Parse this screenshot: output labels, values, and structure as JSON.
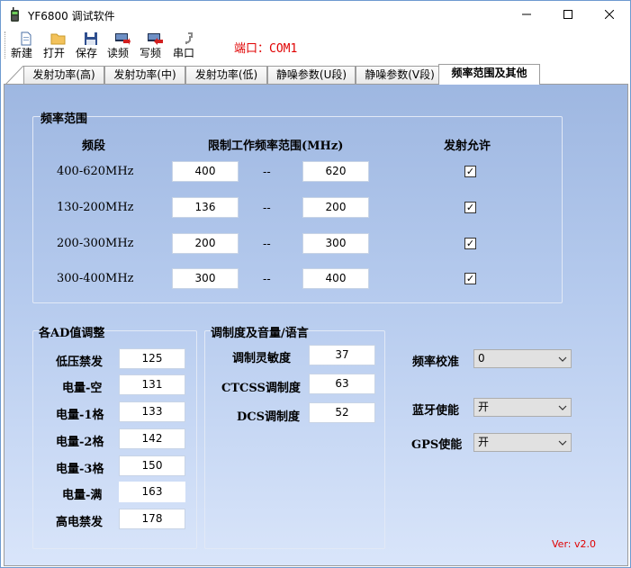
{
  "window": {
    "title": "YF6800 调试软件"
  },
  "toolbar": {
    "new_label": "新建",
    "open_label": "打开",
    "save_label": "保存",
    "read_label": "读频",
    "write_label": "写频",
    "port_btn_label": "串口",
    "port_status": "端口：COM1"
  },
  "tabs": [
    "发射功率(高)",
    "发射功率(中)",
    "发射功率(低)",
    "静噪参数(U段)",
    "静噪参数(V段)",
    "频率范围及其他"
  ],
  "freq_range": {
    "title": "频率范围",
    "col_band": "频段",
    "col_range": "限制工作频率范围(MHz)",
    "col_tx": "发射允许",
    "separator": "--",
    "rows": [
      {
        "band": "400-620MHz",
        "low": "400",
        "high": "620",
        "tx_allowed": true
      },
      {
        "band": "130-200MHz",
        "low": "136",
        "high": "200",
        "tx_allowed": true
      },
      {
        "band": "200-300MHz",
        "low": "200",
        "high": "300",
        "tx_allowed": true
      },
      {
        "band": "300-400MHz",
        "low": "300",
        "high": "400",
        "tx_allowed": true
      }
    ]
  },
  "ad_adjust": {
    "title": "各AD值调整",
    "rows": [
      {
        "label": "低压禁发",
        "value": "125"
      },
      {
        "label": "电量-空",
        "value": "131"
      },
      {
        "label": "电量-1格",
        "value": "133"
      },
      {
        "label": "电量-2格",
        "value": "142"
      },
      {
        "label": "电量-3格",
        "value": "150"
      },
      {
        "label": "电量-满",
        "value": "163"
      },
      {
        "label": "高电禁发",
        "value": "178"
      }
    ]
  },
  "modulation": {
    "title": "调制度及音量/语言",
    "rows": [
      {
        "label": "调制灵敏度",
        "value": "37"
      },
      {
        "label": "CTCSS调制度",
        "value": "63"
      },
      {
        "label": "DCS调制度",
        "value": "52"
      }
    ]
  },
  "settings": {
    "freq_cal_label": "频率校准",
    "freq_cal_value": "0",
    "bt_label": "蓝牙使能",
    "bt_value": "开",
    "gps_label": "GPS使能",
    "gps_value": "开"
  },
  "version": "Ver: v2.0"
}
